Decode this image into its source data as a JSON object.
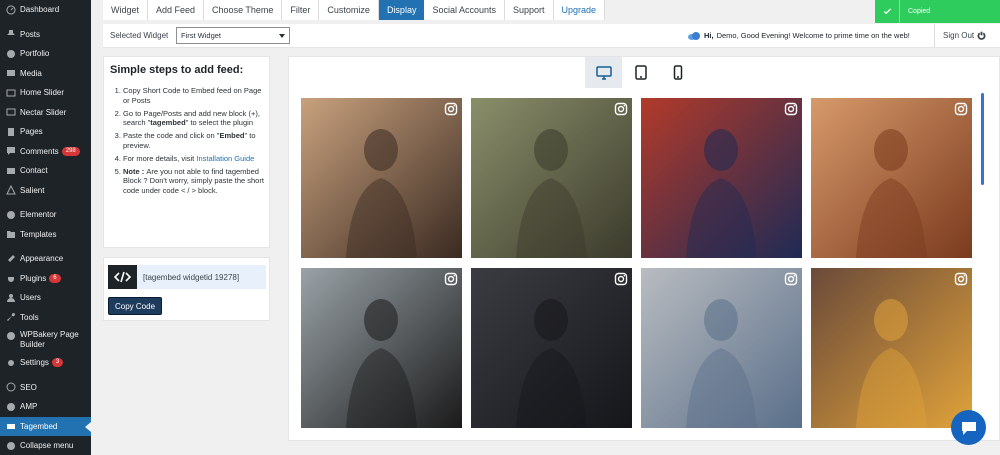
{
  "sidebar": {
    "items": [
      {
        "label": "Dashboard",
        "icon": "dashboard-icon"
      },
      {
        "label": "Posts",
        "icon": "pin-icon"
      },
      {
        "label": "Portfolio",
        "icon": "portfolio-icon"
      },
      {
        "label": "Media",
        "icon": "media-icon"
      },
      {
        "label": "Home Slider",
        "icon": "slider-icon"
      },
      {
        "label": "Nectar Slider",
        "icon": "slider-icon"
      },
      {
        "label": "Pages",
        "icon": "page-icon"
      },
      {
        "label": "Comments",
        "icon": "comment-icon",
        "badge": "298"
      },
      {
        "label": "Contact",
        "icon": "mail-icon"
      },
      {
        "label": "Salient",
        "icon": "salient-icon"
      },
      {
        "label": "Elementor",
        "icon": "elementor-icon"
      },
      {
        "label": "Templates",
        "icon": "folder-icon"
      },
      {
        "label": "Appearance",
        "icon": "brush-icon"
      },
      {
        "label": "Plugins",
        "icon": "plugin-icon",
        "badge": "6"
      },
      {
        "label": "Users",
        "icon": "user-icon"
      },
      {
        "label": "Tools",
        "icon": "wrench-icon"
      },
      {
        "label": "WPBakery Page Builder",
        "icon": "wpbakery-icon"
      },
      {
        "label": "Settings",
        "icon": "settings-icon",
        "badge": "3"
      },
      {
        "label": "SEO",
        "icon": "seo-icon"
      },
      {
        "label": "AMP",
        "icon": "amp-icon"
      },
      {
        "label": "Tagembed",
        "icon": "tagembed-icon",
        "active": true
      },
      {
        "label": "Collapse menu",
        "icon": "collapse-icon"
      }
    ]
  },
  "tabs": [
    {
      "label": "Widget"
    },
    {
      "label": "Add Feed"
    },
    {
      "label": "Choose Theme"
    },
    {
      "label": "Filter"
    },
    {
      "label": "Customize"
    },
    {
      "label": "Display",
      "active": true
    },
    {
      "label": "Social Accounts"
    },
    {
      "label": "Support"
    },
    {
      "label": "Upgrade"
    }
  ],
  "toast": {
    "text": "Copied",
    "color": "#2ecc5c"
  },
  "widget_bar": {
    "label": "Selected Widget",
    "selected": "First Widget",
    "greeting_bold": "Hi,",
    "greeting": "Demo, Good Evening! Welcome to prime time on the web!",
    "signout": "Sign Out"
  },
  "steps": {
    "title": "Simple steps to add feed:",
    "s1": "Copy Short Code to Embed feed on Page or Posts",
    "s2a": "Go to Page/Posts and add new block (+), search \"",
    "s2b": "tagembed",
    "s2c": "\" to select the plugin",
    "s3a": "Paste the code and click on \"",
    "s3b": "Embed",
    "s3c": "\" to preview.",
    "s4a": "For more details, visit ",
    "s4link": "Installation Guide",
    "s5a": "Note : ",
    "s5b": "Are you not able to find tagembed Block ? Don't worry, simply paste the short code under code < / > block."
  },
  "shortcode": {
    "text": "[tagembed widgetid 19278]",
    "button": "Copy Code"
  },
  "preview": {
    "devices": [
      {
        "name": "desktop-icon",
        "active": true
      },
      {
        "name": "tablet-icon"
      },
      {
        "name": "mobile-icon"
      }
    ],
    "posts": [
      {
        "network": "instagram",
        "bg": [
          "#c9a27e",
          "#3a2a22"
        ]
      },
      {
        "network": "instagram",
        "bg": [
          "#8a8f6a",
          "#3b3a2c"
        ]
      },
      {
        "network": "instagram",
        "bg": [
          "#b23a2a",
          "#1e2a55"
        ]
      },
      {
        "network": "instagram",
        "bg": [
          "#d79a6a",
          "#7a3a1e"
        ]
      },
      {
        "network": "instagram",
        "bg": [
          "#9aa3a8",
          "#1a1a1a"
        ]
      },
      {
        "network": "instagram",
        "bg": [
          "#3b3c42",
          "#15161a"
        ]
      },
      {
        "network": "instagram",
        "bg": [
          "#b9bcc0",
          "#5a6f8a"
        ]
      },
      {
        "network": "instagram",
        "bg": [
          "#6a4a3a",
          "#e0a23a"
        ]
      }
    ]
  },
  "colors": {
    "accent": "#2271b1",
    "sidebar": "#1d2327",
    "badge": "#d63638"
  }
}
